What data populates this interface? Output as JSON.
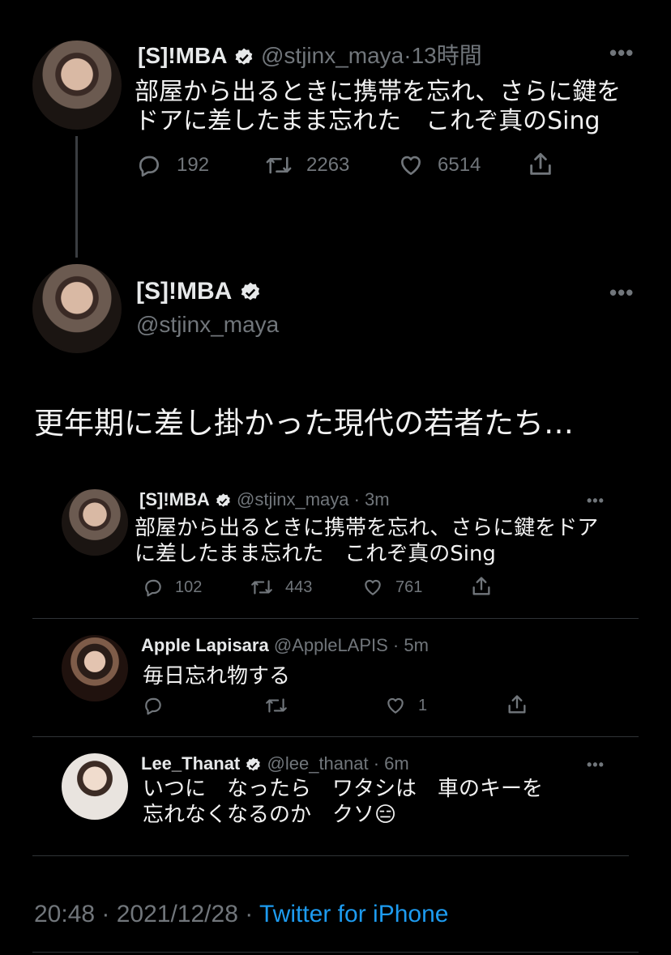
{
  "parent_tweet": {
    "name": "[S]!MBA",
    "handle": "@stjinx_maya",
    "time": "13時間",
    "text_line1": "部屋から出るときに携帯を忘れ、さらに鍵を",
    "text_line2": "ドアに差したまま忘れた　これぞ真のSing",
    "replies": "192",
    "retweets": "2263",
    "likes": "6514"
  },
  "main_tweet": {
    "name": "[S]!MBA",
    "handle": "@stjinx_maya",
    "text": "更年期に差し掛かった現代の若者たち…",
    "timestamp": "20:48 · 2021/12/28 · ",
    "source": "Twitter for iPhone"
  },
  "quoted": [
    {
      "name": "[S]!MBA",
      "handle": "@stjinx_maya · 3m",
      "text_line1": "部屋から出るときに携帯を忘れ、さらに鍵をドア",
      "text_line2": "に差したまま忘れた　これぞ真のSing",
      "replies": "102",
      "retweets": "443",
      "likes": "761"
    },
    {
      "name": "Apple Lapisara",
      "handle": "@AppleLAPIS · 5m",
      "text_line1": "毎日忘れ物する",
      "replies": "",
      "retweets": "",
      "likes": "1"
    },
    {
      "name": "Lee_Thanat",
      "handle": "@lee_thanat · 6m",
      "text_line1": "いつに　なったら　ワタシは　車のキーを",
      "text_line2": "忘れなくなるのか　クソ😑"
    }
  ],
  "icons": {
    "reply": "reply-icon",
    "retweet": "retweet-icon",
    "like": "heart-icon",
    "share": "share-icon",
    "verified": "verified-badge-icon",
    "more": "more-icon"
  },
  "colors": {
    "link": "#1d9bf0",
    "muted": "#71767b",
    "background": "#000000"
  }
}
